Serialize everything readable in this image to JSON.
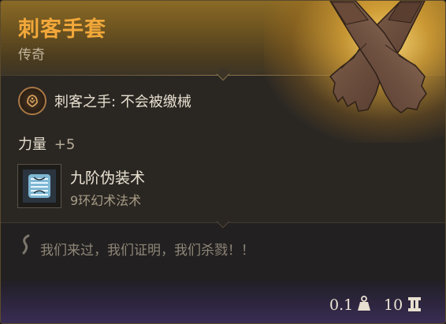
{
  "item": {
    "name": "刺客手套",
    "rarity": "传奇",
    "ability": "刺客之手: 不会被缴械",
    "stat": {
      "name": "力量",
      "value": "+5"
    },
    "spell": {
      "name": "九阶伪装术",
      "type": "9环幻术法术"
    },
    "flavor": "我们来过，我们证明，我们杀戮！！"
  },
  "footer": {
    "weight": "0.1",
    "price": "10"
  },
  "icons": {
    "art": "gloves-art",
    "ability": "assassin-hand-icon",
    "spell": "disguise-spell-icon",
    "flavor": "quote-mark-icon",
    "weight": "weight-icon",
    "price": "gold-coin-icon"
  },
  "colors": {
    "name": "#f2a83a",
    "rarity_header": "#8a6a26",
    "footer": "#3a2d55"
  }
}
